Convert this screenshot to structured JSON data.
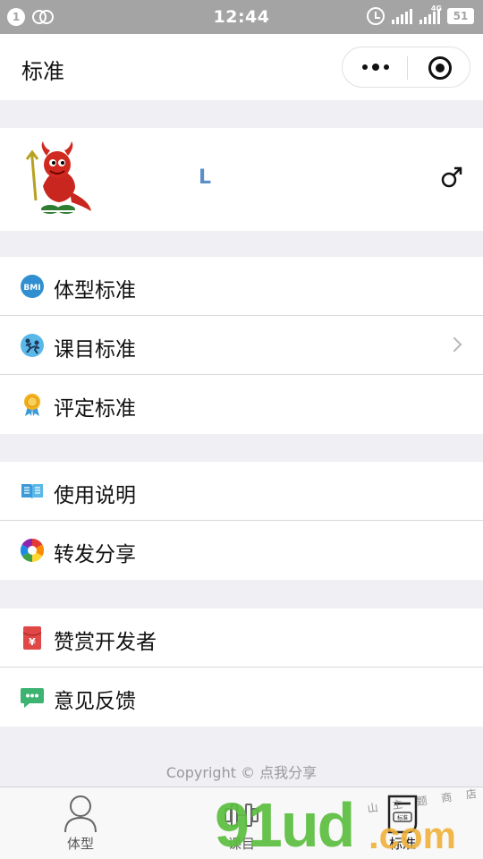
{
  "status_bar": {
    "notification_count": "1",
    "time": "12:44",
    "network_type": "4G",
    "battery": "51"
  },
  "nav": {
    "title": "标准"
  },
  "profile": {
    "username": "L",
    "gender_symbol": "♂"
  },
  "menu_groups": [
    {
      "items": [
        {
          "label": "体型标准",
          "icon": "bmi-icon",
          "icon_text": "BMI"
        },
        {
          "label": "课目标准",
          "icon": "exercise-icon",
          "chevron": true
        },
        {
          "label": "评定标准",
          "icon": "medal-icon"
        }
      ]
    },
    {
      "items": [
        {
          "label": "使用说明",
          "icon": "book-icon"
        },
        {
          "label": "转发分享",
          "icon": "share-aperture-icon"
        }
      ]
    },
    {
      "items": [
        {
          "label": "赞赏开发者",
          "icon": "red-envelope-icon",
          "icon_text": "¥"
        },
        {
          "label": "意见反馈",
          "icon": "chat-bubble-icon"
        }
      ]
    }
  ],
  "footer": {
    "copyright": "Copyright © 点我分享"
  },
  "tabbar": {
    "tabs": [
      {
        "label": "体型",
        "icon": "person-icon",
        "active": false
      },
      {
        "label": "课目",
        "icon": "dumbbell-icon",
        "active": false
      },
      {
        "label": "标准",
        "icon": "document-icon",
        "active": true,
        "icon_text": "标准"
      }
    ]
  },
  "watermark": {
    "main": "91ud",
    "suffix": ".com",
    "shop": "山 主 题 商 店"
  },
  "colors": {
    "status_bar": "#a4a4a4",
    "page_background": "#efeff4",
    "username": "#5a8fc8",
    "bmi_icon": "#2f8fd0",
    "red_envelope": "#e04848",
    "chat_icon": "#3cb371"
  }
}
